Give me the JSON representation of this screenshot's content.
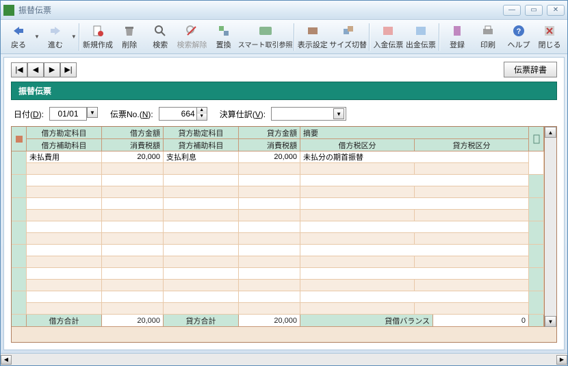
{
  "window": {
    "title": "振替伝票"
  },
  "toolbar": {
    "back": "戻る",
    "forward": "進む",
    "new": "新規作成",
    "delete": "削除",
    "search": "検索",
    "clear_search": "検索解除",
    "replace": "置換",
    "smart_ref": "スマート取引参照",
    "display_settings": "表示設定",
    "size_switch": "サイズ切替",
    "deposit_slip": "入金伝票",
    "withdraw_slip": "出金伝票",
    "register": "登録",
    "print": "印刷",
    "help": "ヘルプ",
    "close": "閉じる"
  },
  "nav": {
    "dict_button": "伝票辞書"
  },
  "section": {
    "title": "振替伝票"
  },
  "form": {
    "date_label": "日付(D):",
    "date_value": "01/01",
    "slip_no_label": "伝票No.(N):",
    "slip_no_value": "664",
    "closing_label": "決算仕訳(V):",
    "closing_value": ""
  },
  "grid": {
    "headers": {
      "debit_account": "借方勘定科目",
      "debit_amount": "借方金額",
      "credit_account": "貸方勘定科目",
      "credit_amount": "貸方金額",
      "summary": "摘要",
      "debit_sub": "借方補助科目",
      "debit_tax_amt": "消費税額",
      "credit_sub": "貸方補助科目",
      "credit_tax_amt": "消費税額",
      "debit_tax_class": "借方税区分",
      "credit_tax_class": "貸方税区分"
    },
    "rows": [
      {
        "debit_account": "未払費用",
        "debit_amount": "20,000",
        "credit_account": "支払利息",
        "credit_amount": "20,000",
        "summary": "未払分の期首振替"
      }
    ],
    "footer": {
      "debit_total_label": "借方合計",
      "debit_total": "20,000",
      "credit_total_label": "貸方合計",
      "credit_total": "20,000",
      "balance_label": "貸借バランス",
      "balance": "0"
    }
  }
}
